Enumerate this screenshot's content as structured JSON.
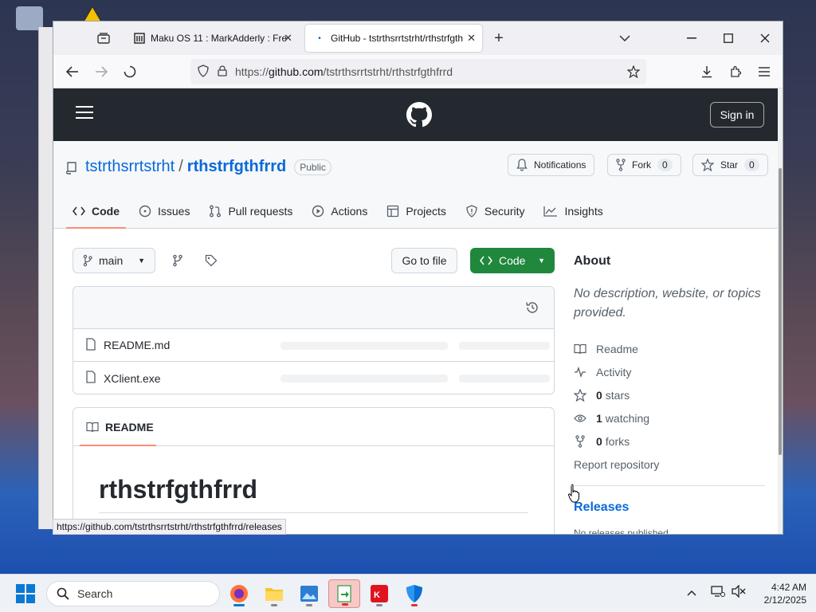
{
  "browser": {
    "tabs": [
      {
        "title": "Maku OS 11 : MarkAdderly : Fre",
        "favicon": "archive-icon",
        "active": false
      },
      {
        "title": "GitHub - tstrthsrrtstrht/rthstrfgth",
        "favicon": "loading-dot-icon",
        "active": true
      }
    ],
    "url_prefix": "https://",
    "url_host": "github.com",
    "url_path": "/tstrthsrrtstrht/rthstrfgthfrrd",
    "status_url": "https://github.com/tstrthsrrtstrht/rthstrfgthfrrd/releases"
  },
  "github": {
    "sign_in": "Sign in",
    "owner": "tstrthsrrtstrht",
    "separator": "/",
    "repo": "rthstrfgthfrrd",
    "visibility": "Public",
    "notifications_label": "Notifications",
    "fork_label": "Fork",
    "fork_count": "0",
    "star_label": "Star",
    "star_count": "0",
    "nav": [
      "Code",
      "Issues",
      "Pull requests",
      "Actions",
      "Projects",
      "Security",
      "Insights"
    ],
    "branch": "main",
    "go_to_file": "Go to file",
    "code_button": "Code",
    "files": [
      "README.md",
      "XClient.exe"
    ],
    "readme_tab": "README",
    "readme_heading": "rthstrfgthfrrd",
    "about": {
      "title": "About",
      "description": "No description, website, or topics provided.",
      "readme": "Readme",
      "activity": "Activity",
      "stars_count": "0",
      "stars_label": "stars",
      "watching_count": "1",
      "watching_label": "watching",
      "forks_count": "0",
      "forks_label": "forks",
      "report": "Report repository",
      "releases_title": "Releases",
      "releases_text": "No releases published"
    }
  },
  "taskbar": {
    "search_placeholder": "Search",
    "time": "4:42 AM",
    "date": "2/12/2025"
  },
  "colors": {
    "gh_header": "#24292f",
    "link_blue": "#0969da",
    "code_green": "#1f883d",
    "tab_underline": "#fd8c73"
  }
}
